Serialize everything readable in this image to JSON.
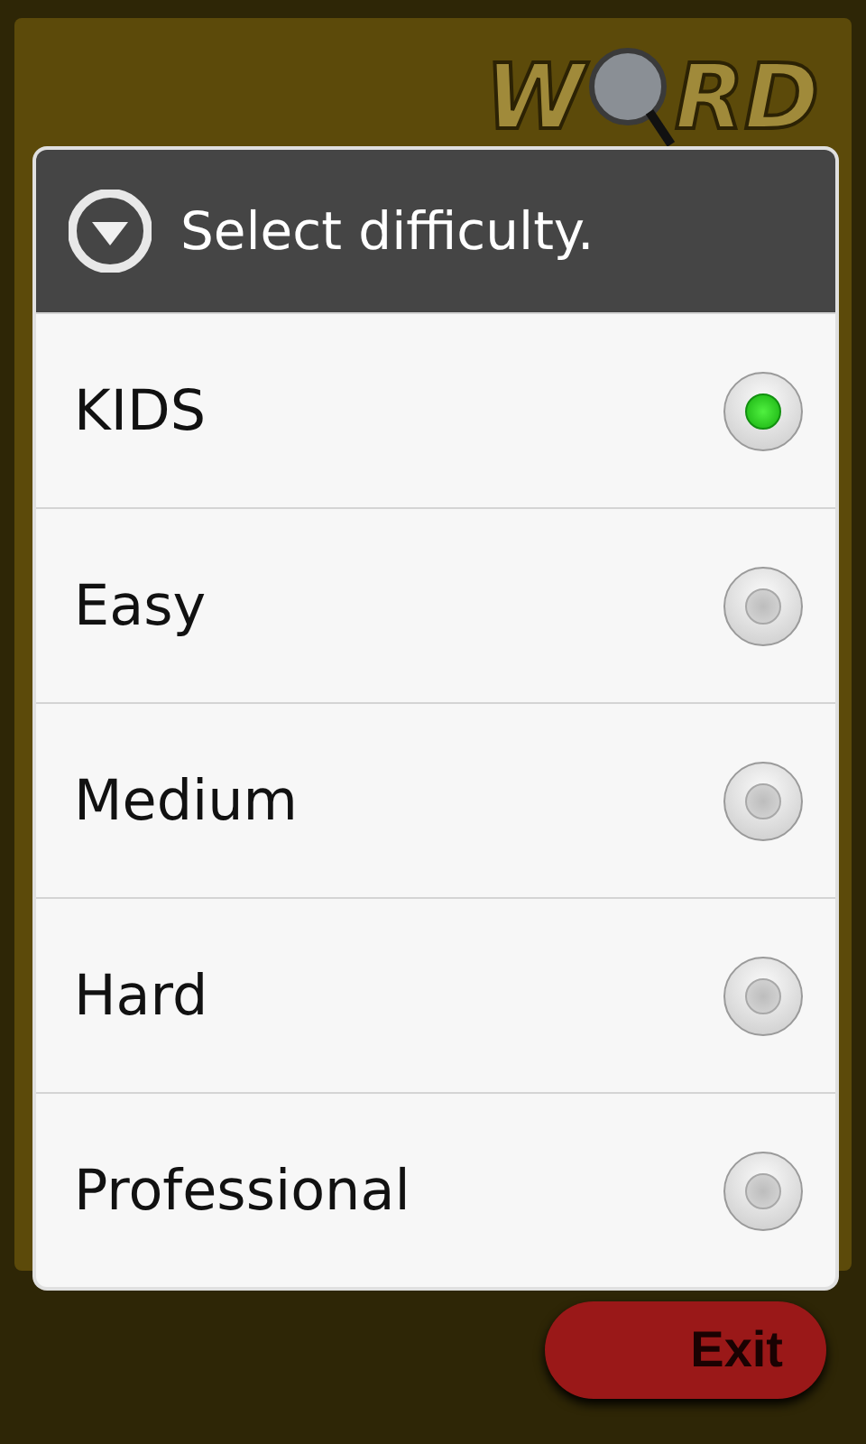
{
  "background": {
    "logo": [
      "W",
      "RD"
    ],
    "exit_button": "Exit"
  },
  "dialog": {
    "title": "Select difficulty.",
    "options": [
      {
        "label": "KIDS",
        "selected": true
      },
      {
        "label": "Easy",
        "selected": false
      },
      {
        "label": "Medium",
        "selected": false
      },
      {
        "label": "Hard",
        "selected": false
      },
      {
        "label": "Professional",
        "selected": false
      }
    ]
  }
}
